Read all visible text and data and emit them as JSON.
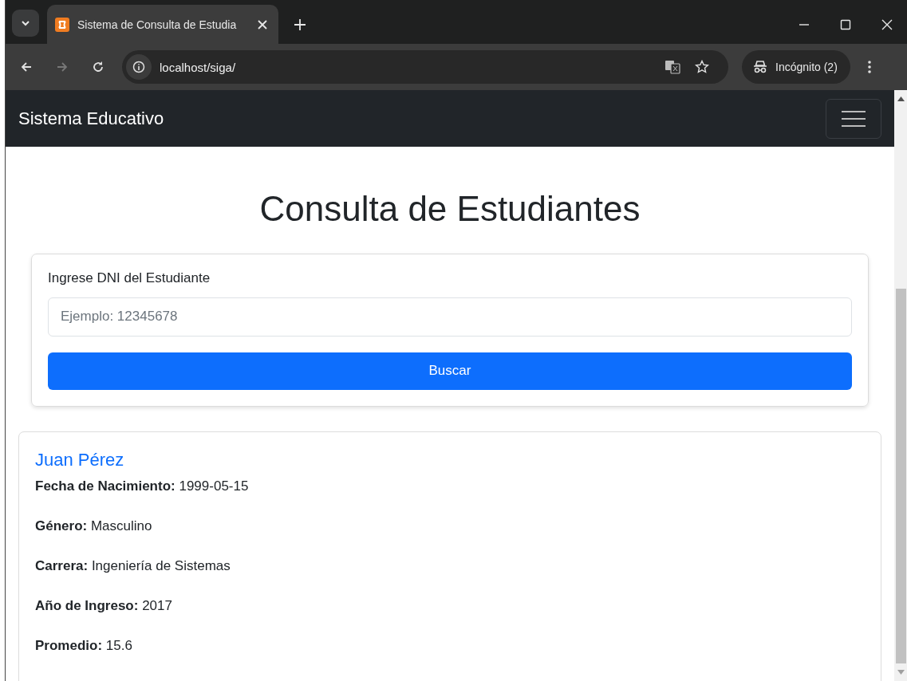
{
  "browser": {
    "tab_title": "Sistema de Consulta de Estudia",
    "address": "localhost/siga/",
    "profile": "Incógnito (2)"
  },
  "navbar": {
    "brand": "Sistema Educativo"
  },
  "page": {
    "heading": "Consulta de Estudiantes",
    "form": {
      "label": "Ingrese DNI del Estudiante",
      "placeholder": "Ejemplo: 12345678",
      "button": "Buscar"
    },
    "result": {
      "name": "Juan Pérez",
      "fields": [
        {
          "text": "**Fecha de Nacimiento:** 1999-05-15"
        },
        {
          "text": "**Género:** Masculino"
        },
        {
          "text": "**Carrera:** Ingeniería de Sistemas"
        },
        {
          "text": "**Año de Ingreso:** 2017"
        },
        {
          "text": "**Promedio:** 15.6"
        }
      ]
    }
  }
}
